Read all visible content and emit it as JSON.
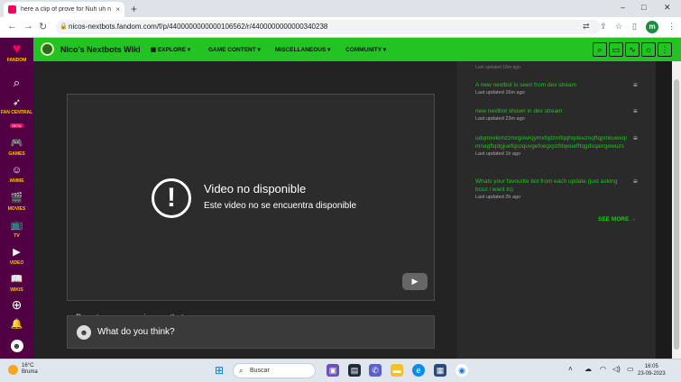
{
  "browser": {
    "tab_title": "here a clip of prove for Nuh uh n",
    "tab_close": "×",
    "new_tab": "+",
    "url": "nicos-nextbots.fandom.com/f/p/4400000000000106562/r/4400000000000340238",
    "profile_initial": "m",
    "win_min": "–",
    "win_max": "□",
    "win_close": "✕"
  },
  "fandom_rail": {
    "items": [
      {
        "label": "FANDOM",
        "icon": "fandom-logo-icon"
      },
      {
        "label": "",
        "icon": "search-icon"
      },
      {
        "label": "FAN CENTRAL",
        "icon": "rocket-icon",
        "badge": "BETA"
      },
      {
        "label": "GAMES",
        "icon": "gamepad-icon"
      },
      {
        "label": "ANIME",
        "icon": "anime-icon"
      },
      {
        "label": "MOVIES",
        "icon": "clapper-icon"
      },
      {
        "label": "TV",
        "icon": "tv-icon"
      },
      {
        "label": "VIDEO",
        "icon": "play-icon"
      },
      {
        "label": "WIKIS",
        "icon": "book-icon"
      }
    ]
  },
  "wiki_nav": {
    "name": "Nico's Nextbots Wiki",
    "menus": [
      "EXPLORE",
      "GAME CONTENT",
      "MISCELLANEOUS",
      "COMMUNITY"
    ],
    "explore_icon": "▦"
  },
  "video": {
    "error_title": "Video no disponible",
    "error_sub": "Este video no se encuentra disponible",
    "post_title": "Dev stream upcoming nextbots"
  },
  "comment": {
    "placeholder": "What do you think?"
  },
  "rail": {
    "top_updated": "Last updated 18m ago",
    "items": [
      {
        "title": "A new nextbot is seen from dev stream",
        "updated": "Last updated 16m ago"
      },
      {
        "title": "new nextbot shown in dev stream",
        "updated": "Last updated 23m ago"
      },
      {
        "title": "udqmxxkimzzmrgowrqymxfqdzmfqqhqdeuzoqftqpmkuwxqimnagftqdgjuefqcoquvgefoegxpzfdqeuefftqgdsqarrgowuzs",
        "updated": "Last updated 1h ago"
      },
      {
        "title": "Whats your favourite bot from each update (just asking bcuz i want to)",
        "updated": "Last updated 2h ago"
      }
    ],
    "see_more": "SEE MORE"
  },
  "taskbar": {
    "temp": "16°C",
    "weather": "Bruma",
    "search": "Buscar",
    "time": "16:05",
    "date": "23-09-2023"
  },
  "colors": {
    "fandom": "#520044",
    "wiki_green": "#22c322",
    "main_bg": "#232323"
  }
}
